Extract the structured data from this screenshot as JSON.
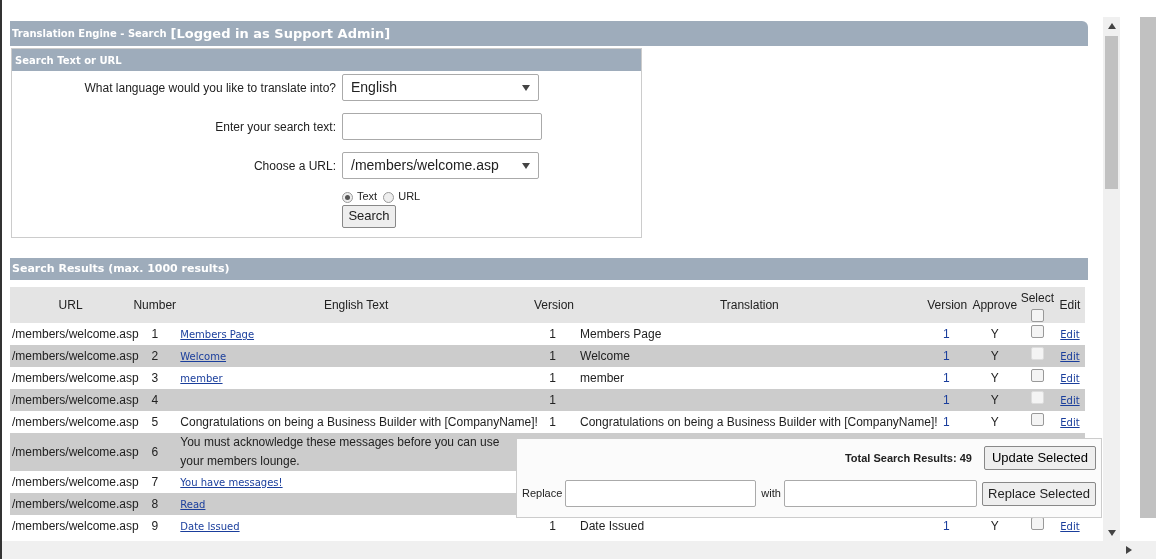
{
  "page_header": {
    "title": "Translation Engine - Search",
    "login": "[Logged in as Support Admin]"
  },
  "search_panel": {
    "title": "Search Text or URL",
    "language": {
      "label": "What language would you like to translate into?",
      "value": "English"
    },
    "search_text": {
      "label": "Enter your search text:"
    },
    "url": {
      "label": "Choose a URL:",
      "value": "/members/welcome.asp"
    },
    "modes": [
      {
        "label": "Text",
        "selected": true
      },
      {
        "label": "URL",
        "selected": false
      }
    ],
    "button": "Search"
  },
  "results": {
    "title": "Search Results (max. 1000 results)",
    "columns": [
      "URL",
      "Number",
      "English Text",
      "Version",
      "Translation",
      "Version",
      "Approve",
      "Select",
      "Edit"
    ],
    "select_all": {
      "checked": false
    },
    "rows": [
      {
        "url": "/members/welcome.asp",
        "number": "1",
        "english": "Members Page",
        "kind": "link",
        "version": "1",
        "translation": "Members Page",
        "translation_version": "1",
        "approve": "Y",
        "checked": false,
        "edit": "Edit"
      },
      {
        "url": "/members/welcome.asp",
        "number": "2",
        "english": "Welcome",
        "kind": "link",
        "version": "1",
        "translation": "Welcome",
        "translation_version": "1",
        "approve": "Y",
        "checked": false,
        "edit": "Edit"
      },
      {
        "url": "/members/welcome.asp",
        "number": "3",
        "english": "member",
        "kind": "link",
        "version": "1",
        "translation": "member",
        "translation_version": "1",
        "approve": "Y",
        "checked": false,
        "edit": "Edit"
      },
      {
        "url": "/members/welcome.asp",
        "number": "4",
        "version": "1",
        "translation_version": "1",
        "approve": "Y",
        "checked": false,
        "edit": "Edit"
      },
      {
        "url": "/members/welcome.asp",
        "number": "5",
        "english": "Congratulations on being a Business Builder with [CompanyName]!",
        "kind": "text",
        "version": "1",
        "translation": "Congratulations on being a Business Builder with [CompanyName]!",
        "translation_version": "1",
        "approve": "Y",
        "checked": false,
        "edit": "Edit"
      },
      {
        "url": "/members/welcome.asp",
        "number": "6",
        "english": "You must acknowledge these messages before you can use your members lounge.",
        "kind": "text"
      },
      {
        "url": "/members/welcome.asp",
        "number": "7",
        "english": "You have messages!",
        "kind": "link"
      },
      {
        "url": "/members/welcome.asp",
        "number": "8",
        "english": "Read",
        "kind": "link"
      },
      {
        "url": "/members/welcome.asp",
        "number": "9",
        "english": "Date Issued",
        "kind": "link",
        "version": "1",
        "translation": "Date Issued",
        "translation_version": "1",
        "approve": "Y",
        "checked": false,
        "edit": "Edit"
      }
    ]
  },
  "bulk_panel": {
    "total": "Total Search Results: 49",
    "update_button": "Update Selected",
    "replace_label": "Replace",
    "with_label": "with",
    "replace_button": "Replace Selected"
  }
}
